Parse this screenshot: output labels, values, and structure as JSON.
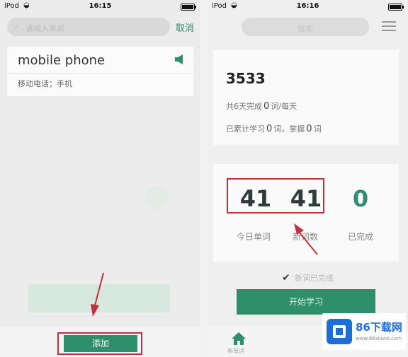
{
  "left_screen": {
    "status": {
      "carrier": "iPod",
      "time": "16:15"
    },
    "search": {
      "placeholder": "请输入单词"
    },
    "cancel_label": "取消",
    "word_card": {
      "word": "mobile phone",
      "meaning": "移动电话；手机"
    },
    "add_button_label": "添加"
  },
  "right_screen": {
    "status": {
      "carrier": "iPod",
      "time": "16:16"
    },
    "search": {
      "placeholder": "搜索"
    },
    "stats": {
      "total_words": "3533",
      "line1_prefix": "共6天完成",
      "line1_value": "0",
      "line1_suffix": "词/每天",
      "line2_prefix": "已累计学习",
      "line2_value": "0",
      "line2_mid": "词，掌握",
      "line2_value2": "0",
      "line2_suffix": "词"
    },
    "counts": {
      "today_words_value": "41",
      "today_words_label": "今日单词",
      "new_words_value": "41",
      "new_words_label": "新词数",
      "completed_value": "0",
      "completed_label": "已完成"
    },
    "done_line_label": "新词已完成",
    "start_button_label": "开始学习",
    "tab_home_label": "新单词"
  },
  "watermark": {
    "brand": "86下载网",
    "domain": "www.86xiazai.com"
  },
  "colors": {
    "accent_green": "#2f8f6d",
    "highlight_red": "#c0303e",
    "watermark_blue": "#1d6fd6"
  }
}
